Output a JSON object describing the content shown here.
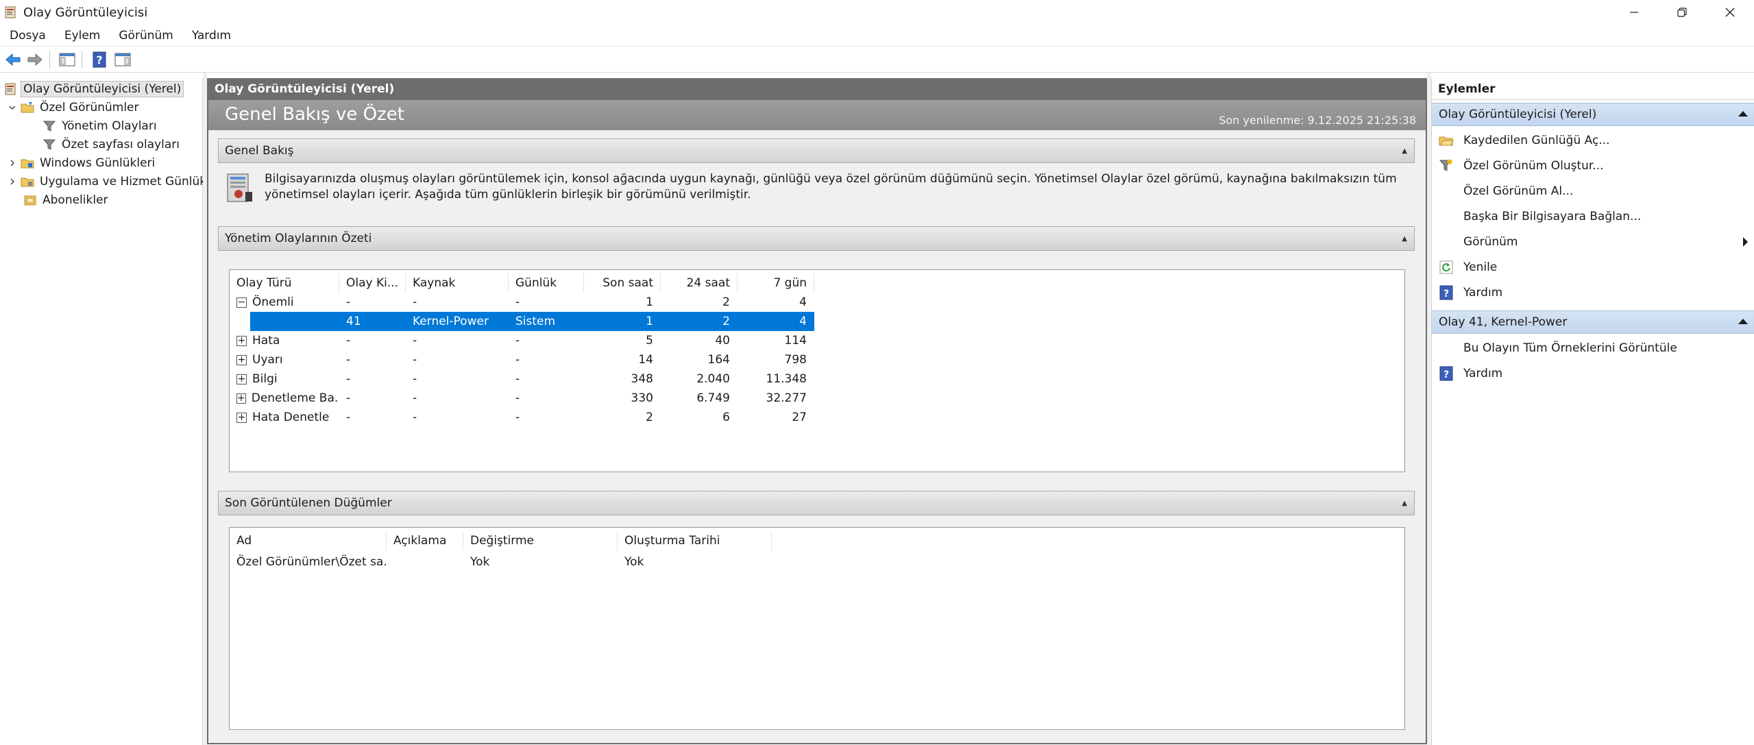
{
  "window": {
    "title": "Olay Görüntüleyicisi"
  },
  "menu": [
    "Dosya",
    "Eylem",
    "Görünüm",
    "Yardım"
  ],
  "tree": {
    "root": "Olay Görüntüleyicisi (Yerel)",
    "custom_views": "Özel Görünümler",
    "admin_events": "Yönetim Olayları",
    "summary_events": "Özet sayfası olayları",
    "windows_logs": "Windows Günlükleri",
    "app_service_logs": "Uygulama ve Hizmet Günlükl",
    "subscriptions": "Abonelikler"
  },
  "center": {
    "header": "Olay Görüntüleyicisi (Yerel)",
    "banner_title": "Genel Bakış ve Özet",
    "refresh": "Son yenilenme: 9.12.2025 21:25:38",
    "overview": {
      "title": "Genel Bakış",
      "text": "Bilgisayarınızda oluşmuş olayları görüntülemek için, konsol ağacında uygun kaynağı, günlüğü veya özel görünüm düğümünü seçin. Yönetimsel Olaylar özel görümü, kaynağına bakılmaksızın tüm yönetimsel olayları içerir. Aşağıda tüm günlüklerin birleşik bir görümünü verilmiştir."
    },
    "summary": {
      "title": "Yönetim Olaylarının Özeti",
      "columns": [
        "Olay Türü",
        "Olay Ki...",
        "Kaynak",
        "Günlük",
        "Son saat",
        "24 saat",
        "7 gün"
      ],
      "rows": [
        {
          "expander": "−",
          "type": "Önemli",
          "id": "-",
          "source": "-",
          "log": "-",
          "hour": "1",
          "day": "2",
          "week": "4"
        },
        {
          "expander": "",
          "type": "",
          "id": "41",
          "source": "Kernel-Power",
          "log": "Sistem",
          "hour": "1",
          "day": "2",
          "week": "4"
        },
        {
          "expander": "+",
          "type": "Hata",
          "id": "-",
          "source": "-",
          "log": "-",
          "hour": "5",
          "day": "40",
          "week": "114"
        },
        {
          "expander": "+",
          "type": "Uyarı",
          "id": "-",
          "source": "-",
          "log": "-",
          "hour": "14",
          "day": "164",
          "week": "798"
        },
        {
          "expander": "+",
          "type": "Bilgi",
          "id": "-",
          "source": "-",
          "log": "-",
          "hour": "348",
          "day": "2.040",
          "week": "11.348"
        },
        {
          "expander": "+",
          "type": "Denetleme Ba...",
          "id": "-",
          "source": "-",
          "log": "-",
          "hour": "330",
          "day": "6.749",
          "week": "32.277"
        },
        {
          "expander": "+",
          "type": "Hata Denetle",
          "id": "-",
          "source": "-",
          "log": "-",
          "hour": "2",
          "day": "6",
          "week": "27"
        }
      ]
    },
    "recent": {
      "title": "Son Görüntülenen Düğümler",
      "columns": [
        "Ad",
        "Açıklama",
        "Değiştirme",
        "Oluşturma Tarihi"
      ],
      "rows": [
        {
          "name": "Özel Görünümler\\Özet sa...",
          "desc": "",
          "modified": "Yok",
          "created": "Yok"
        }
      ]
    }
  },
  "actions": {
    "title": "Eylemler",
    "group1": "Olay Görüntüleyicisi (Yerel)",
    "items1": [
      "Kaydedilen Günlüğü Aç...",
      "Özel Görünüm Oluştur...",
      "Özel Görünüm Al...",
      "Başka Bir Bilgisayara Bağlan...",
      "Görünüm",
      "Yenile",
      "Yardım"
    ],
    "group2": "Olay 41, Kernel-Power",
    "items2": [
      "Bu Olayın Tüm Örneklerini Görüntüle",
      "Yardım"
    ]
  }
}
